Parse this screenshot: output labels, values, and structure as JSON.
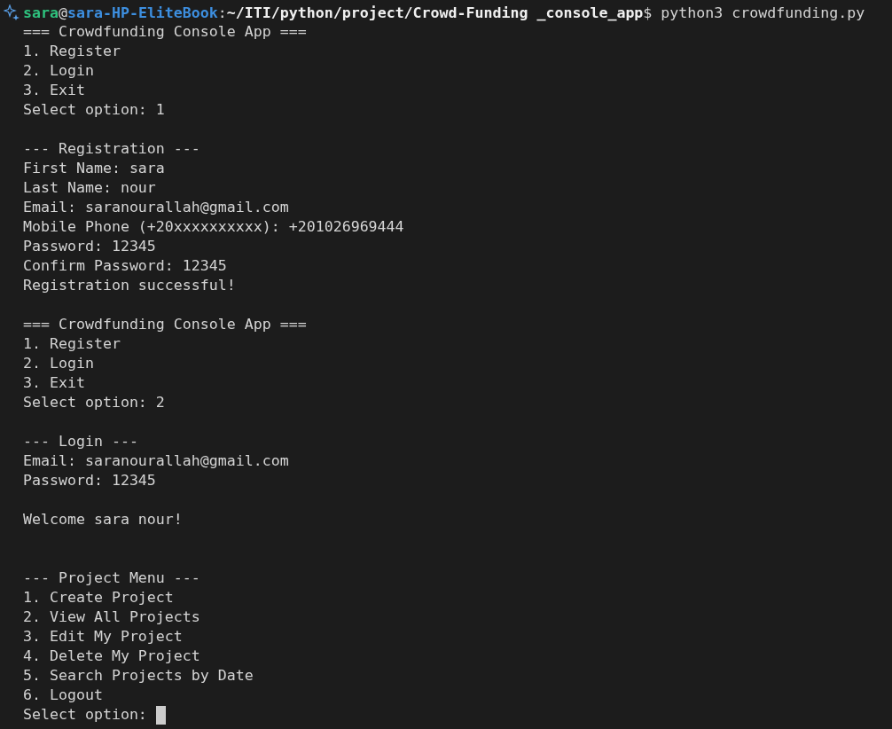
{
  "prompt": {
    "user": "sara",
    "at": "@",
    "host": "sara-HP-EliteBook",
    "colon": ":",
    "path": "~/ITI/python/project/Crowd-Funding _console_app",
    "dollar": "$",
    "command": " python3 crowdfunding.py"
  },
  "blocks": [
    {
      "kind": "section",
      "lines": [
        "=== Crowdfunding Console App ===",
        "1. Register",
        "2. Login",
        "3. Exit",
        "Select option: 1"
      ]
    },
    {
      "kind": "section",
      "lines": [
        "--- Registration ---",
        "First Name: sara",
        "Last Name: nour",
        "Email: saranourallah@gmail.com",
        "Mobile Phone (+20xxxxxxxxxx): +201026969444",
        "Password: 12345",
        "Confirm Password: 12345",
        "Registration successful!"
      ]
    },
    {
      "kind": "section",
      "lines": [
        "=== Crowdfunding Console App ===",
        "1. Register",
        "2. Login",
        "3. Exit",
        "Select option: 2"
      ]
    },
    {
      "kind": "section",
      "lines": [
        "--- Login ---",
        "Email: saranourallah@gmail.com",
        "Password: 12345"
      ]
    },
    {
      "kind": "section",
      "lines": [
        "Welcome sara nour!"
      ]
    },
    {
      "kind": "spaced",
      "lines": [
        "--- Project Menu ---",
        "1. Create Project",
        "2. View All Projects",
        "3. Edit My Project",
        "4. Delete My Project",
        "5. Search Projects by Date",
        "6. Logout",
        "Select option: "
      ]
    }
  ],
  "cursor_visible": true
}
